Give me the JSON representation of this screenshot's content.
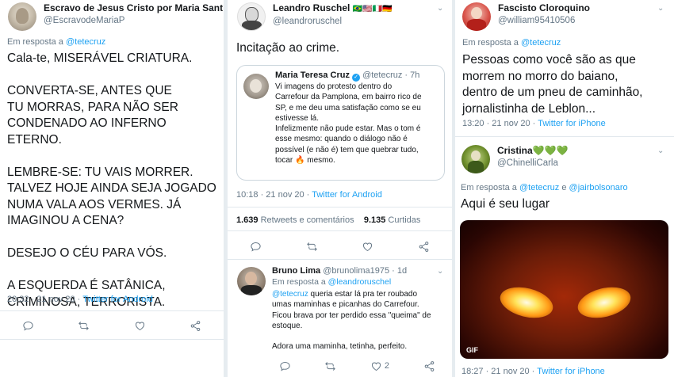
{
  "col1": {
    "name": "Escravo de Jesus Cristo por Maria Santí…",
    "handle": "@EscravodeMariaP",
    "reply_prefix": "Em resposta a",
    "reply_to": "@tetecruz",
    "text": "Cala-te, MISERÁVEL CRIATURA.\n\nCONVERTA-SE, ANTES QUE\nTU MORRAS, PARA NÃO SER\nCONDENADO AO INFERNO ETERNO.\n\nLEMBRE-SE: TU VAIS MORRER.\nTALVEZ HOJE AINDA SEJA JOGADO\nNUMA VALA AOS VERMES. JÁ\nIMAGINOU A CENA?\n\nDESEJO O CÉU PARA VÓS.\n\nA ESQUERDA É SATÂNICA,\nCRIMINOSA, TERRORISTA.",
    "time": "20:32 · 21 nov 20 ·",
    "source": "Twitter for Android"
  },
  "col2": {
    "name": "Leandro Ruschel",
    "flags": "🇧🇷🇺🇸🇮🇹🇩🇪",
    "handle": "@leandroruschel",
    "text": "Incitação ao crime.",
    "quote": {
      "name": "Maria Teresa Cruz",
      "handle": "@tetecruz · 7h",
      "text": "Vi imagens do protesto dentro do\nCarrefour da Pamplona, em bairro rico de\nSP, e me deu uma satisfação como se eu\nestivesse lá.\nInfelizmente não pude estar. Mas o tom é\nesse mesmo: quando o diálogo não é\npossível (e não é) tem que quebrar tudo,\ntocar 🔥 mesmo."
    },
    "time": "10:18 · 21 nov 20 ·",
    "source": "Twitter for Android",
    "retweets_count": "1.639",
    "retweets_label": "Retweets e comentários",
    "likes_count": "9.135",
    "likes_label": "Curtidas",
    "reply": {
      "name": "Bruno Lima",
      "handle": "@brunolima1975 · 1d",
      "reply_prefix": "Em resposta a",
      "reply_to": "@leandroruschel",
      "mention": "@tetecruz",
      "text_after_mention": " queria estar lá  pra ter roubado",
      "text": "umas maminhas e picanhas do Carrefour.\nFicou brava por ter perdido essa \"queima\" de\nestoque.\n\nAdora uma maminha, tetinha,  perfeito.",
      "like_count": "2"
    }
  },
  "col3": {
    "name": "Fascisto Cloroquino",
    "handle": "@william95410506",
    "reply_prefix": "Em resposta a",
    "reply_to": "@tetecruz",
    "text": "Pessoas como você são as que\nmorrem no morro do baiano,\ndentro de um pneu de caminhão,\njornalistinha de Leblon...",
    "time": "13:20 · 21 nov 20 ·",
    "source": "Twitter for iPhone",
    "reply": {
      "name": "Cristina💚💚💚",
      "handle": "@ChinelliCarla",
      "reply_prefix": "Em resposta a",
      "reply_to": "@tetecruz",
      "reply_and": "e",
      "reply_to2": "@jairbolsonaro",
      "text": "Aqui é seu  lugar",
      "gif_label": "GIF",
      "time": "18:27 · 21 nov 20 ·",
      "source": "Twitter for iPhone"
    }
  },
  "colors": {
    "link": "#1da1f2",
    "muted": "#657786",
    "border": "#e1e8ed"
  },
  "icons": [
    "reply-icon",
    "retweet-icon",
    "like-icon",
    "share-icon",
    "chevron-down-icon",
    "verified-icon"
  ]
}
